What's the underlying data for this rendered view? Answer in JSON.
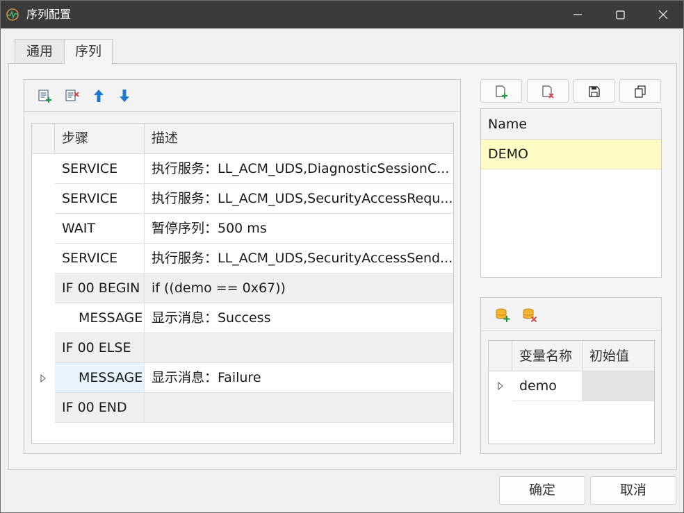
{
  "window": {
    "title": "序列配置"
  },
  "tabs": [
    {
      "label": "通用",
      "active": false
    },
    {
      "label": "序列",
      "active": true
    }
  ],
  "steps_table": {
    "columns": [
      "步骤",
      "描述"
    ],
    "rows": [
      {
        "step": "SERVICE",
        "description": "执行服务：LL_ACM_UDS,DiagnosticSessionC...",
        "block": false,
        "indent": false,
        "current": false
      },
      {
        "step": "SERVICE",
        "description": "执行服务：LL_ACM_UDS,SecurityAccessRequ...",
        "block": false,
        "indent": false,
        "current": false
      },
      {
        "step": "WAIT",
        "description": "暂停序列：500 ms",
        "block": false,
        "indent": false,
        "current": false
      },
      {
        "step": "SERVICE",
        "description": "执行服务：LL_ACM_UDS,SecurityAccessSend...",
        "block": false,
        "indent": false,
        "current": false
      },
      {
        "step": "IF 00 BEGIN",
        "description": "if ((demo == 0x67))",
        "block": true,
        "indent": false,
        "current": false
      },
      {
        "step": "MESSAGE",
        "description": "显示消息：Success",
        "block": false,
        "indent": true,
        "current": false
      },
      {
        "step": "IF 00 ELSE",
        "description": "",
        "block": true,
        "indent": false,
        "current": false
      },
      {
        "step": "MESSAGE",
        "description": "显示消息：Failure",
        "block": false,
        "indent": true,
        "current": true
      },
      {
        "step": "IF 00 END",
        "description": "",
        "block": true,
        "indent": false,
        "current": false
      }
    ]
  },
  "sequence_list": {
    "header": "Name",
    "items": [
      "DEMO"
    ]
  },
  "variables_table": {
    "columns": [
      "变量名称",
      "初始值"
    ],
    "rows": [
      {
        "name": "demo",
        "initial": ""
      }
    ]
  },
  "footer": {
    "ok_label": "确定",
    "cancel_label": "取消"
  },
  "colors": {
    "titlebar": "#3b3b3b",
    "selected_sequence": "#fdfcc4",
    "arrow_blue": "#1e78d2",
    "add_green": "#1a9a3a",
    "remove_red": "#d63a3a",
    "database_orange": "#e8a21a"
  },
  "icons": {
    "left_toolbar": [
      "add-step-icon",
      "remove-step-icon",
      "move-up-icon",
      "move-down-icon"
    ],
    "sequence_toolbar": [
      "new-sequence-icon",
      "delete-sequence-icon",
      "save-icon",
      "copy-icon"
    ],
    "variable_toolbar": [
      "add-variable-icon",
      "remove-variable-icon"
    ]
  }
}
